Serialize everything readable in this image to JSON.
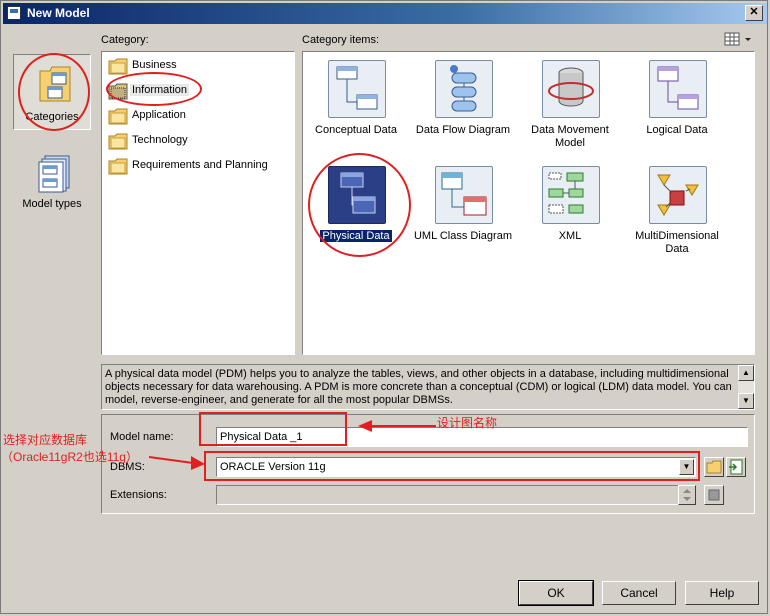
{
  "window": {
    "title": "New Model"
  },
  "labels": {
    "category": "Category:",
    "category_items": "Category items:"
  },
  "left_panel": {
    "categories_label": "Categories",
    "model_types_label": "Model types"
  },
  "categories": [
    {
      "label": "Business",
      "selected": false
    },
    {
      "label": "Information",
      "selected": true
    },
    {
      "label": "Application",
      "selected": false
    },
    {
      "label": "Technology",
      "selected": false
    },
    {
      "label": "Requirements and Planning",
      "selected": false
    }
  ],
  "items": [
    {
      "label": "Conceptual Data",
      "icon": "conceptual-data-icon",
      "selected": false
    },
    {
      "label": "Data Flow Diagram",
      "icon": "data-flow-diagram-icon",
      "selected": false
    },
    {
      "label": "Data Movement Model",
      "icon": "data-movement-model-icon",
      "selected": false
    },
    {
      "label": "Logical Data",
      "icon": "logical-data-icon",
      "selected": false
    },
    {
      "label": "Physical Data",
      "icon": "physical-data-icon",
      "selected": true
    },
    {
      "label": "UML Class Diagram",
      "icon": "uml-class-diagram-icon",
      "selected": false
    },
    {
      "label": "XML",
      "icon": "xml-icon",
      "selected": false
    },
    {
      "label": "MultiDimensional Data",
      "icon": "multidimensional-data-icon",
      "selected": false
    }
  ],
  "description": "A physical data model (PDM) helps you to analyze the tables, views, and other objects in a database, including multidimensional objects necessary for data warehousing. A PDM is more concrete than a conceptual (CDM) or logical (LDM) data model. You can model, reverse-engineer, and generate for all the most popular DBMSs.",
  "form": {
    "model_name_label": "Model name:",
    "model_name_value": "Physical Data _1",
    "dbms_label": "DBMS:",
    "dbms_value": "ORACLE Version 11g",
    "extensions_label": "Extensions:",
    "extensions_value": ""
  },
  "buttons": {
    "ok": "OK",
    "cancel": "Cancel",
    "help": "Help"
  },
  "annotations": {
    "design_name": "设计图名称",
    "select_db_line1": "选择对应数据库",
    "select_db_line2": "（Oracle11gR2也选11g）"
  },
  "colors": {
    "annotation": "#e02020",
    "title_bar": "#0a246a",
    "selection": "#0a246a"
  }
}
